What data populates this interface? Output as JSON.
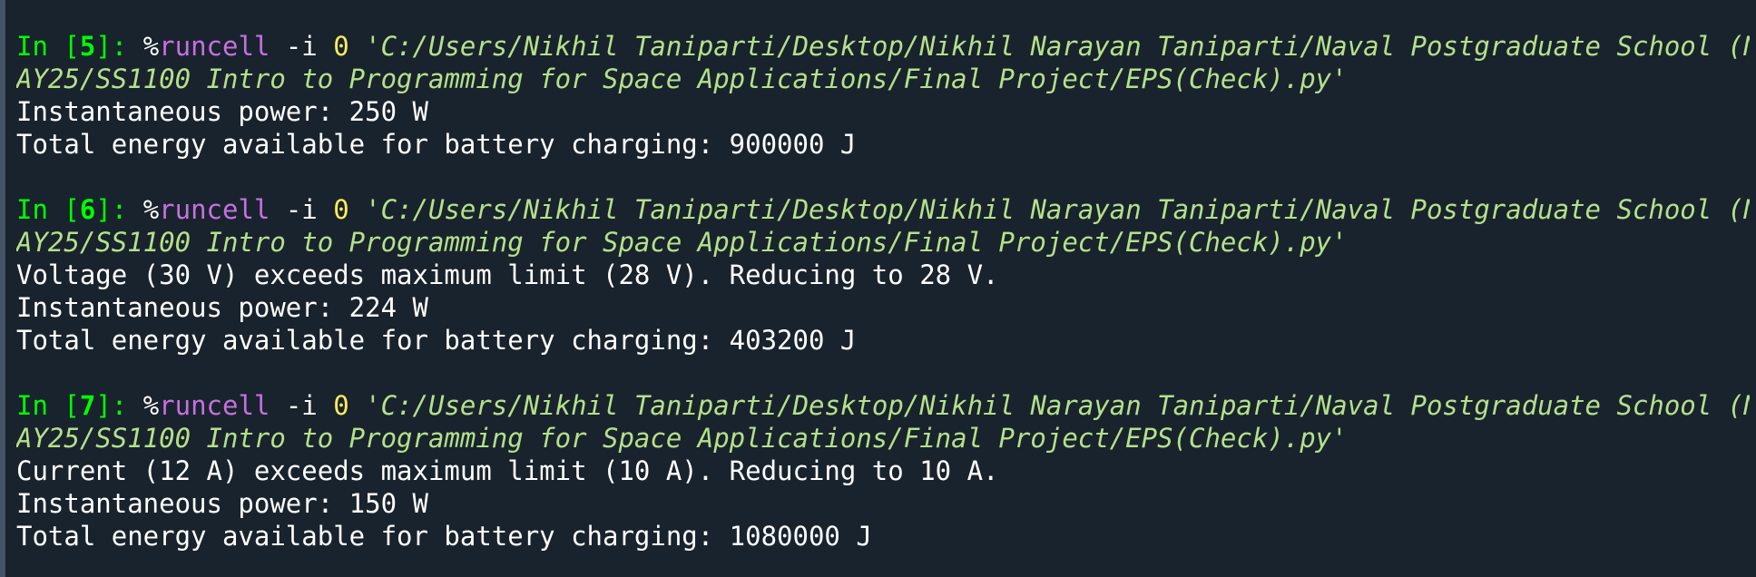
{
  "colors": {
    "background": "#19232d",
    "prompt": "#00ff00",
    "magic": "#c670e0",
    "number_arg": "#faed5c",
    "string_path": "#b5e08a",
    "output_text": "#ffffff"
  },
  "cells": [
    {
      "prompt_prefix": "In [",
      "number": "5",
      "prompt_suffix": "]: ",
      "magic_pct": "%",
      "magic_name": "runcell",
      "flag": " -i ",
      "arg": "0",
      "path_line1": " 'C:/Users/Nikhil Taniparti/Desktop/Nikhil Narayan Taniparti/Naval Postgraduate School (NPS)/Fall",
      "path_line2": "AY25/SS1100 Intro to Programming for Space Applications/Final Project/EPS(Check).py'",
      "output": [
        "Instantaneous power: 250 W",
        "Total energy available for battery charging: 900000 J"
      ]
    },
    {
      "prompt_prefix": "In [",
      "number": "6",
      "prompt_suffix": "]: ",
      "magic_pct": "%",
      "magic_name": "runcell",
      "flag": " -i ",
      "arg": "0",
      "path_line1": " 'C:/Users/Nikhil Taniparti/Desktop/Nikhil Narayan Taniparti/Naval Postgraduate School (NPS)/Fall",
      "path_line2": "AY25/SS1100 Intro to Programming for Space Applications/Final Project/EPS(Check).py'",
      "output": [
        "Voltage (30 V) exceeds maximum limit (28 V). Reducing to 28 V.",
        "Instantaneous power: 224 W",
        "Total energy available for battery charging: 403200 J"
      ]
    },
    {
      "prompt_prefix": "In [",
      "number": "7",
      "prompt_suffix": "]: ",
      "magic_pct": "%",
      "magic_name": "runcell",
      "flag": " -i ",
      "arg": "0",
      "path_line1": " 'C:/Users/Nikhil Taniparti/Desktop/Nikhil Narayan Taniparti/Naval Postgraduate School (NPS)/Fall",
      "path_line2": "AY25/SS1100 Intro to Programming for Space Applications/Final Project/EPS(Check).py'",
      "output": [
        "Current (12 A) exceeds maximum limit (10 A). Reducing to 10 A.",
        "Instantaneous power: 150 W",
        "Total energy available for battery charging: 1080000 J"
      ]
    }
  ]
}
